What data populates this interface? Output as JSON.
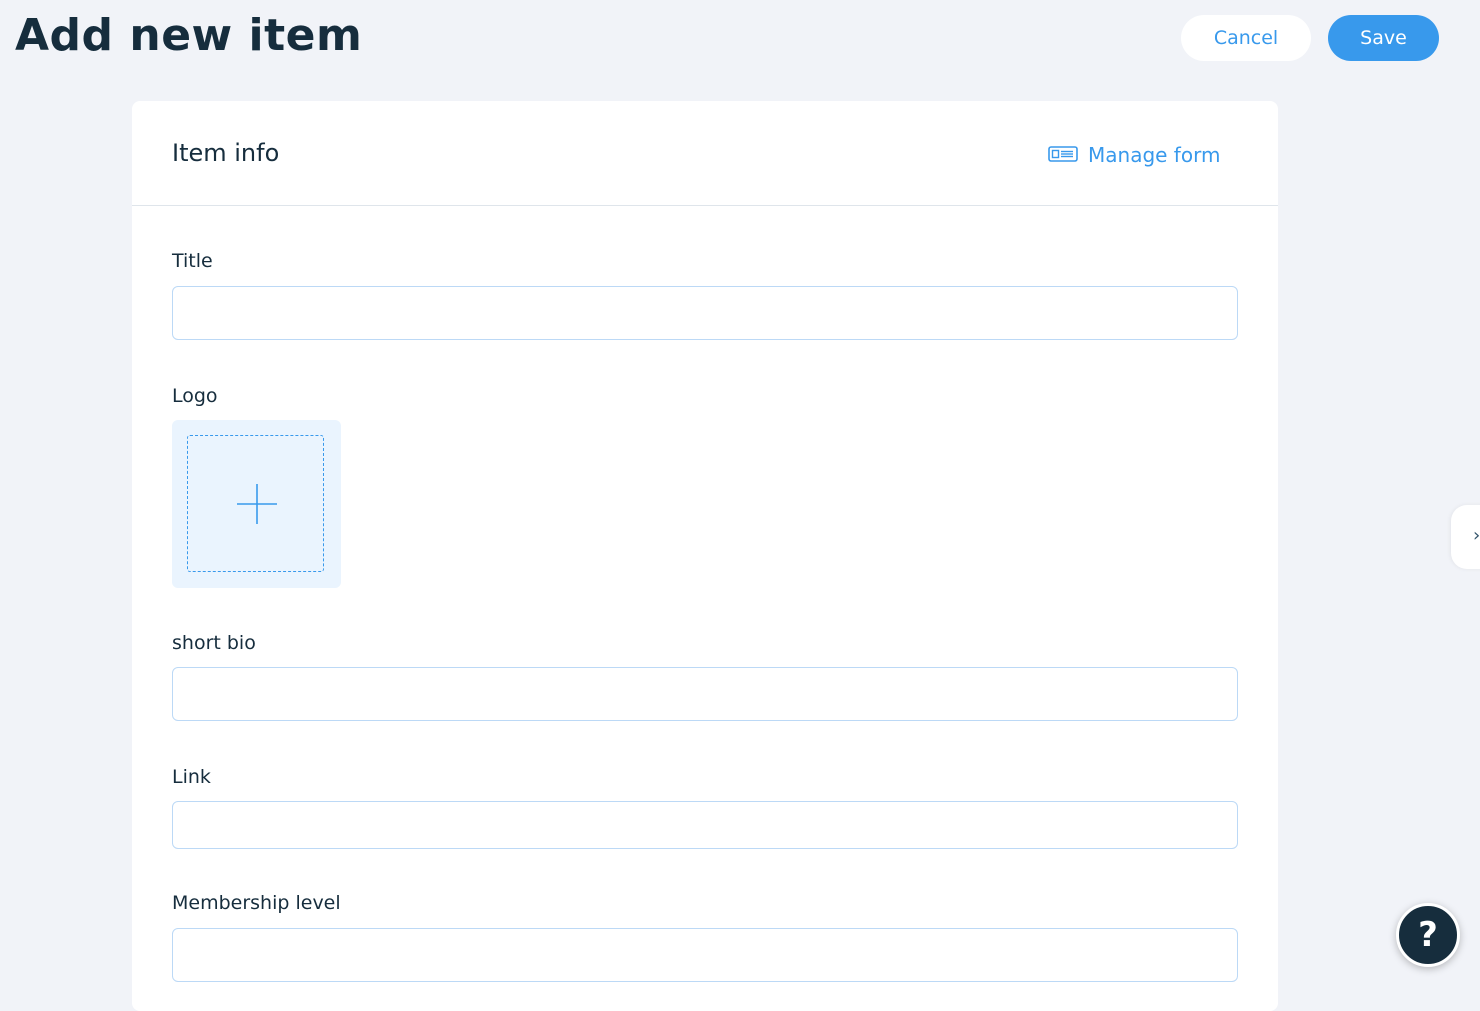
{
  "header": {
    "title": "Add new item",
    "cancel_label": "Cancel",
    "save_label": "Save"
  },
  "card": {
    "title": "Item info",
    "manage_form_label": "Manage form",
    "manage_form_icon": "form-icon"
  },
  "fields": {
    "title": {
      "label": "Title",
      "value": "",
      "placeholder": ""
    },
    "logo": {
      "label": "Logo",
      "icon": "plus-icon"
    },
    "short_bio": {
      "label": "short bio",
      "value": "",
      "placeholder": ""
    },
    "link": {
      "label": "Link",
      "value": "",
      "placeholder": ""
    },
    "membership_level": {
      "label": "Membership level",
      "value": "",
      "placeholder": ""
    }
  },
  "help": {
    "label": "?",
    "icon": "help-icon"
  },
  "side_panel": {
    "icon": "chevron-right-icon",
    "glyph": "›"
  },
  "colors": {
    "accent": "#3899ec",
    "title_text": "#162d3d",
    "background": "#f1f3f8",
    "input_border": "#bcd9f6",
    "uploader_bg": "#eaf4fe"
  }
}
